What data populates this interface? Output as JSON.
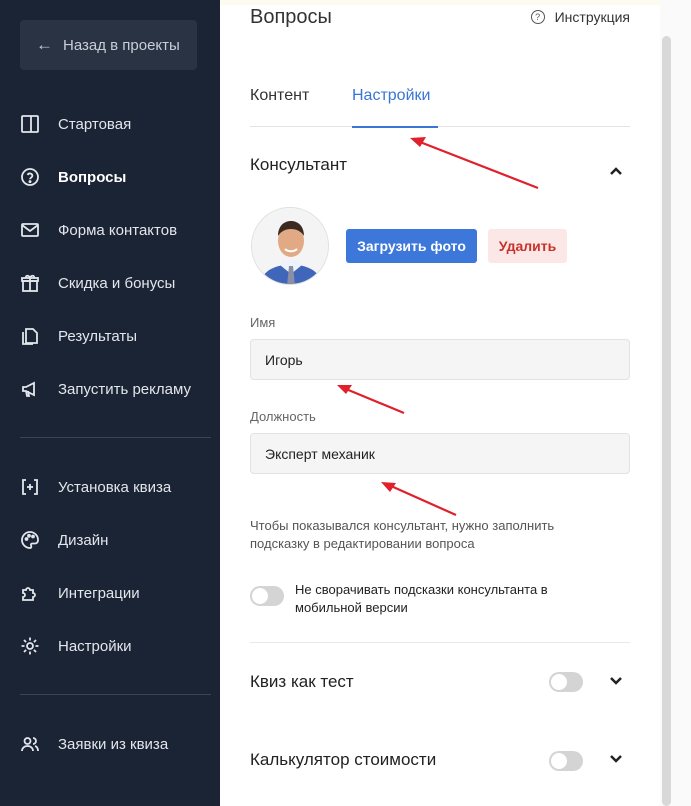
{
  "sidebar": {
    "back_label": "Назад в проекты",
    "items": [
      {
        "label": "Стартовая",
        "icon": "layout-icon"
      },
      {
        "label": "Вопросы",
        "icon": "question-icon"
      },
      {
        "label": "Форма контактов",
        "icon": "mail-icon"
      },
      {
        "label": "Скидка и бонусы",
        "icon": "gift-icon"
      },
      {
        "label": "Результаты",
        "icon": "copy-icon"
      },
      {
        "label": "Запустить рекламу",
        "icon": "megaphone-icon"
      },
      {
        "label": "Установка квиза",
        "icon": "install-icon"
      },
      {
        "label": "Дизайн",
        "icon": "palette-icon"
      },
      {
        "label": "Интеграции",
        "icon": "puzzle-icon"
      },
      {
        "label": "Настройки",
        "icon": "gear-icon"
      },
      {
        "label": "Заявки из квиза",
        "icon": "users-icon"
      }
    ],
    "active_item": "Вопросы"
  },
  "header": {
    "title": "Вопросы",
    "instruction_label": "Инструкция"
  },
  "tabs": [
    {
      "label": "Контент",
      "active": false
    },
    {
      "label": "Настройки",
      "active": true
    }
  ],
  "consultant": {
    "title": "Консультант",
    "upload_label": "Загрузить фото",
    "delete_label": "Удалить",
    "name_label": "Имя",
    "name_value": "Игорь",
    "position_label": "Должность",
    "position_value": "Эксперт механик",
    "hint": "Чтобы показывался консультант, нужно заполнить подсказку в редактировании вопроса",
    "mobile_toggle_label": "Не сворачивать подсказки консультанта в мобильной версии"
  },
  "sections": [
    {
      "title": "Квиз как тест"
    },
    {
      "title": "Калькулятор стоимости"
    }
  ],
  "colors": {
    "sidebar_bg": "#1b2434",
    "accent": "#3d77d9",
    "danger": "#c8322a",
    "annotation_arrow": "#e0202a"
  }
}
